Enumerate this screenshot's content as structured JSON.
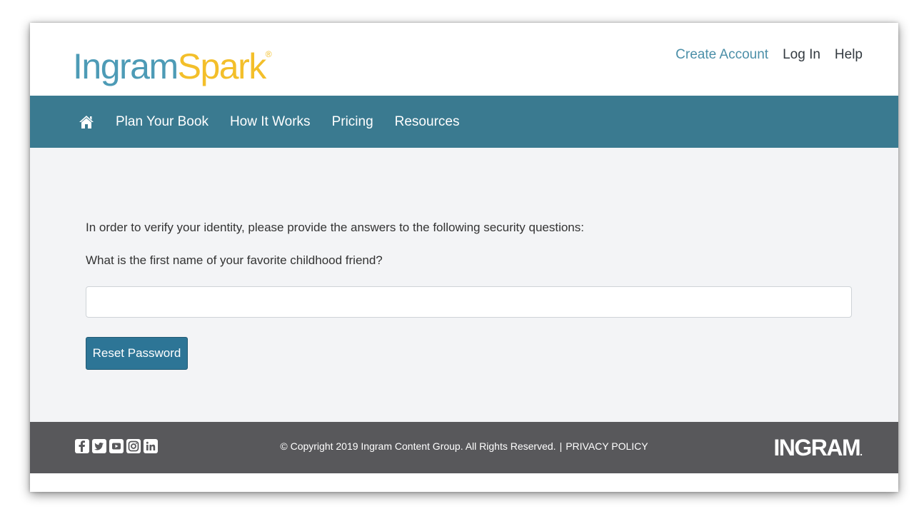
{
  "header": {
    "logo": {
      "part1": "Ingram",
      "part2": "Spark",
      "reg": "®"
    },
    "links": {
      "create_account": "Create Account",
      "log_in": "Log In",
      "help": "Help"
    }
  },
  "nav": {
    "home_icon": "home-icon",
    "items": [
      "Plan Your Book",
      "How It Works",
      "Pricing",
      "Resources"
    ]
  },
  "main": {
    "instructions": "In order to verify your identity, please provide the answers to the following security questions:",
    "question": "What is the first name of your favorite childhood friend?",
    "answer": {
      "value": "",
      "placeholder": ""
    },
    "reset_button": "Reset Password"
  },
  "footer": {
    "social_icons": [
      "facebook-icon",
      "twitter-icon",
      "youtube-icon",
      "instagram-icon",
      "linkedin-icon"
    ],
    "copyright": "© Copyright 2019 Ingram Content Group. All Rights Reserved.",
    "separator": "|",
    "privacy": "PRIVACY POLICY",
    "logo": "INGRAM",
    "logo_dot": "."
  },
  "colors": {
    "brand_blue": "#4d9bb6",
    "brand_yellow": "#f3bf2a",
    "nav_bg": "#3a7a90",
    "button_bg": "#2d7596",
    "footer_bg": "#58585b",
    "main_bg": "#f3f4f6"
  }
}
